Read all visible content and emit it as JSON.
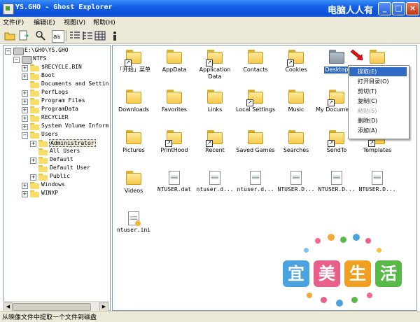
{
  "window": {
    "title": "YS.GHO - Ghost Explorer",
    "watermark_top": "电脑人人有",
    "buttons": {
      "minimize": "_",
      "maximize": "□",
      "close": "×"
    }
  },
  "menu": [
    {
      "label": "文件(F)"
    },
    {
      "label": "编辑(E)"
    },
    {
      "label": "视图(V)"
    },
    {
      "label": "帮助(H)"
    }
  ],
  "toolbar": {
    "icons": [
      "open-folder-icon",
      "save-icon",
      "search-icon",
      "view-small-icon",
      "view-list-icon",
      "view-details-icon",
      "view-large-icon",
      "properties-icon"
    ]
  },
  "tree": {
    "root": "E:\\GHO\\YS.GHO",
    "drive": "NTFS",
    "items": [
      {
        "label": "$RECYCLE.BIN",
        "expander": "+"
      },
      {
        "label": "Boot",
        "expander": "+"
      },
      {
        "label": "Documents and Settin",
        "expander": ""
      },
      {
        "label": "PerfLogs",
        "expander": "+"
      },
      {
        "label": "Program Files",
        "expander": "+"
      },
      {
        "label": "ProgramData",
        "expander": "+"
      },
      {
        "label": "RECYCLER",
        "expander": "+"
      },
      {
        "label": "System Volume Inform",
        "expander": "+"
      },
      {
        "label": "Users",
        "expander": "−"
      },
      {
        "label": "Administrator",
        "expander": "+"
      },
      {
        "label": "All Users",
        "expander": ""
      },
      {
        "label": "Default",
        "expander": "+"
      },
      {
        "label": "Default User",
        "expander": ""
      },
      {
        "label": "Public",
        "expander": "+"
      },
      {
        "label": "Windows",
        "expander": "+"
      },
      {
        "label": "WINXP",
        "expander": "+"
      }
    ]
  },
  "files": [
    {
      "name": "「开始」菜单",
      "kind": "folder",
      "shortcut": true
    },
    {
      "name": "AppData",
      "kind": "folder",
      "shortcut": false
    },
    {
      "name": "Application Data",
      "kind": "folder",
      "shortcut": true
    },
    {
      "name": "Contacts",
      "kind": "folder",
      "shortcut": false
    },
    {
      "name": "Cookies",
      "kind": "folder",
      "shortcut": true
    },
    {
      "name": "Desktop",
      "kind": "folder-selected",
      "shortcut": false
    },
    {
      "name": "",
      "kind": "folder",
      "shortcut": false
    },
    {
      "name": "Downloads",
      "kind": "folder",
      "shortcut": false
    },
    {
      "name": "Favorites",
      "kind": "folder",
      "shortcut": false
    },
    {
      "name": "Links",
      "kind": "folder",
      "shortcut": false
    },
    {
      "name": "Local Settings",
      "kind": "folder",
      "shortcut": true
    },
    {
      "name": "Music",
      "kind": "folder",
      "shortcut": false
    },
    {
      "name": "My Documents",
      "kind": "folder",
      "shortcut": true
    },
    {
      "name": "",
      "kind": "folder",
      "shortcut": false
    },
    {
      "name": "Pictures",
      "kind": "folder",
      "shortcut": false
    },
    {
      "name": "PrintHood",
      "kind": "folder",
      "shortcut": true
    },
    {
      "name": "Recent",
      "kind": "folder",
      "shortcut": true
    },
    {
      "name": "Saved Games",
      "kind": "folder",
      "shortcut": false
    },
    {
      "name": "Searches",
      "kind": "folder",
      "shortcut": false
    },
    {
      "name": "SendTo",
      "kind": "folder",
      "shortcut": true
    },
    {
      "name": "Templates",
      "kind": "folder",
      "shortcut": true
    },
    {
      "name": "Videos",
      "kind": "folder",
      "shortcut": false
    },
    {
      "name": "NTUSER.dat",
      "kind": "doc",
      "shortcut": false
    },
    {
      "name": "ntuser.d...",
      "kind": "doc",
      "shortcut": false
    },
    {
      "name": "ntuser.d...",
      "kind": "doc",
      "shortcut": false
    },
    {
      "name": "NTUSER.D...",
      "kind": "doc",
      "shortcut": false
    },
    {
      "name": "NTUSER.D...",
      "kind": "doc",
      "shortcut": false
    },
    {
      "name": "NTUSER.D...",
      "kind": "doc",
      "shortcut": false
    },
    {
      "name": "ntuser.ini",
      "kind": "doc-ini",
      "shortcut": false
    }
  ],
  "context_menu": [
    {
      "label": "提取(E)",
      "state": "active"
    },
    {
      "label": "打开目录(O)",
      "state": "normal"
    },
    {
      "label": "剪切(T)",
      "state": "normal"
    },
    {
      "label": "复制(C)",
      "state": "normal"
    },
    {
      "label": "粘贴(S)",
      "state": "disabled"
    },
    {
      "label": "删除(D)",
      "state": "normal"
    },
    {
      "label": "添加(A)",
      "state": "normal"
    }
  ],
  "status": "从映像文件中提取一个文件到磁盘",
  "watermark_logo": [
    "宜",
    "美",
    "生",
    "活"
  ],
  "colors": {
    "titlebar": "#0a4fd6",
    "selection": "#316ac5",
    "logo_tiles": [
      "#4aa3df",
      "#e8608a",
      "#f0a020",
      "#58b848"
    ]
  }
}
